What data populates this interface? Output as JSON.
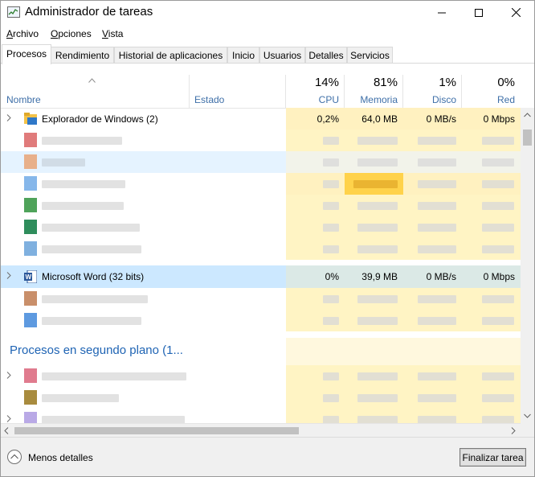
{
  "window": {
    "title": "Administrador de tareas"
  },
  "menu": [
    {
      "label": "Archivo",
      "accel": "A",
      "rest": "rchivo"
    },
    {
      "label": "Opciones",
      "accel": "O",
      "rest": "pciones"
    },
    {
      "label": "Vista",
      "accel": "V",
      "rest": "ista"
    }
  ],
  "tabs": [
    "Procesos",
    "Rendimiento",
    "Historial de aplicaciones",
    "Inicio",
    "Usuarios",
    "Detalles",
    "Servicios"
  ],
  "active_tab": "Procesos",
  "columns": {
    "name": "Nombre",
    "status": "Estado",
    "cpu": {
      "label": "CPU",
      "percent": "14%"
    },
    "memory": {
      "label": "Memoria",
      "percent": "81%"
    },
    "disk": {
      "label": "Disco",
      "percent": "1%"
    },
    "network": {
      "label": "Red",
      "percent": "0%"
    }
  },
  "rows": {
    "explorer": {
      "name": "Explorador de Windows (2)",
      "cpu": "0,2%",
      "memory": "64,0 MB",
      "disk": "0 MB/s",
      "network": "0 Mbps"
    },
    "word": {
      "name": "Microsoft Word (32 bits)",
      "cpu": "0%",
      "memory": "39,9 MB",
      "disk": "0 MB/s",
      "network": "0 Mbps"
    }
  },
  "group_background": "Procesos en segundo plano (1...",
  "footer": {
    "less_details": "Menos detalles",
    "end_task": "Finalizar tarea"
  },
  "colors": {
    "heat_light": "#fff4c4",
    "heat_medium": "#ffe9a0",
    "heat_high": "#ffd24a",
    "selection": "#cce8ff",
    "hover": "#e5f3ff",
    "group_text": "#1f64b4",
    "header_text": "#3e6fa8"
  },
  "icons": {
    "app": "task-manager-icon",
    "explorer": "folder-icon",
    "word": "word-icon"
  }
}
